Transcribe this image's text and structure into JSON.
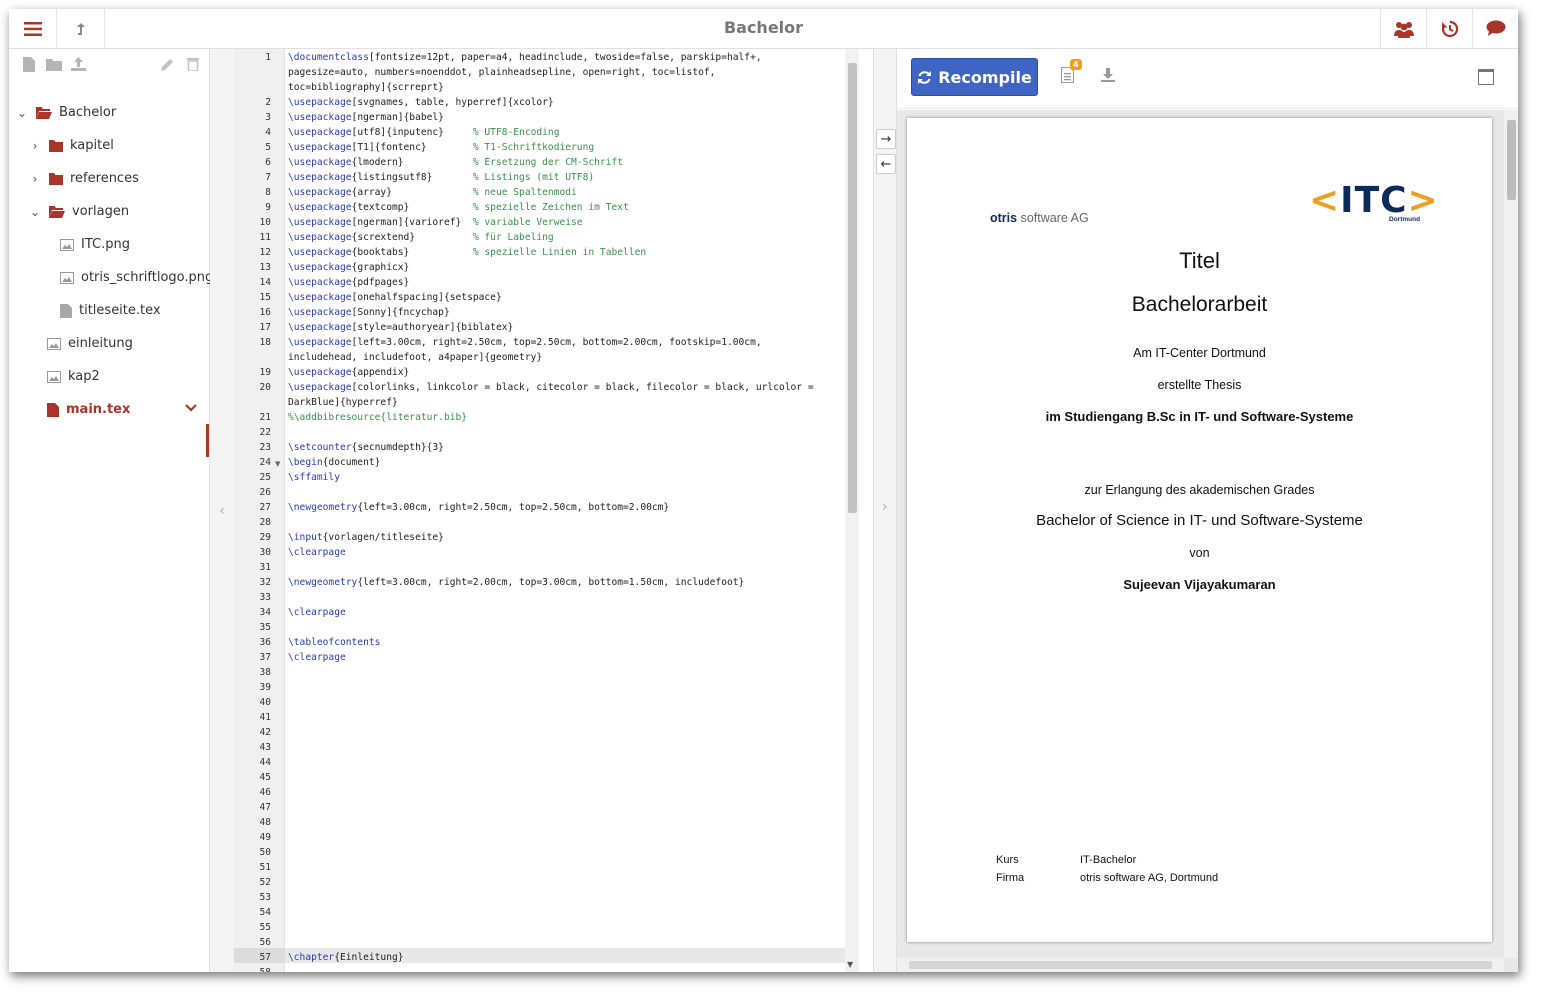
{
  "project_title": "Bachelor",
  "file_tree": {
    "root": "Bachelor",
    "items": [
      {
        "label": "kapitel",
        "type": "folder",
        "expanded": false
      },
      {
        "label": "references",
        "type": "folder",
        "expanded": false
      },
      {
        "label": "vorlagen",
        "type": "folder",
        "expanded": true
      },
      {
        "label": "ITC.png",
        "type": "image"
      },
      {
        "label": "otris_schriftlogo.png",
        "type": "image"
      },
      {
        "label": "titleseite.tex",
        "type": "file"
      },
      {
        "label": "einleitung",
        "type": "image"
      },
      {
        "label": "kap2",
        "type": "image"
      },
      {
        "label": "main.tex",
        "type": "file",
        "selected": true
      }
    ]
  },
  "editor": {
    "line_numbers": [
      "1",
      "",
      "",
      "2",
      "3",
      "4",
      "5",
      "6",
      "7",
      "8",
      "9",
      "10",
      "11",
      "12",
      "13",
      "14",
      "15",
      "16",
      "17",
      "18",
      "",
      "19",
      "20",
      "",
      "21",
      "22",
      "23",
      "24",
      "25",
      "26",
      "27",
      "28",
      "29",
      "30",
      "31",
      "32",
      "33",
      "34",
      "35",
      "36",
      "37",
      "38",
      "39",
      "40",
      "41",
      "42",
      "43",
      "44",
      "45",
      "46",
      "47",
      "48",
      "49",
      "50",
      "51",
      "52",
      "53",
      "54",
      "55",
      "56",
      "57",
      "58"
    ],
    "lines": [
      {
        "k": "\\documentclass",
        "t": "[fontsize=12pt, paper=a4, headinclude, twoside=false, parskip=half+,",
        "c": ""
      },
      {
        "k": "",
        "t": "pagesize=auto, numbers=noenddot, plainheadsepline, open=right, toc=listof,",
        "c": ""
      },
      {
        "k": "",
        "t": "toc=bibliography]{scrreprt}",
        "c": ""
      },
      {
        "k": "\\usepackage",
        "t": "[svgnames, table, hyperref]{xcolor}",
        "c": ""
      },
      {
        "k": "\\usepackage",
        "t": "[ngerman]{babel}",
        "c": ""
      },
      {
        "k": "\\usepackage",
        "t": "[utf8]{inputenc}     ",
        "c": "% UTF8-Encoding"
      },
      {
        "k": "\\usepackage",
        "t": "[T1]{fontenc}        ",
        "c": "% T1-Schriftkodierung"
      },
      {
        "k": "\\usepackage",
        "t": "{lmodern}            ",
        "c": "% Ersetzung der CM-Schrift"
      },
      {
        "k": "\\usepackage",
        "t": "{listingsutf8}       ",
        "c": "% Listings (mit UTF8)"
      },
      {
        "k": "\\usepackage",
        "t": "{array}              ",
        "c": "% neue Spaltenmodi"
      },
      {
        "k": "\\usepackage",
        "t": "{textcomp}           ",
        "c": "% spezielle Zeichen im Text"
      },
      {
        "k": "\\usepackage",
        "t": "[ngerman]{varioref}  ",
        "c": "% variable Verweise"
      },
      {
        "k": "\\usepackage",
        "t": "{scrextend}          ",
        "c": "% für Labeling"
      },
      {
        "k": "\\usepackage",
        "t": "{booktabs}           ",
        "c": "% spezielle Linien in Tabellen"
      },
      {
        "k": "\\usepackage",
        "t": "{graphicx}",
        "c": ""
      },
      {
        "k": "\\usepackage",
        "t": "{pdfpages}",
        "c": ""
      },
      {
        "k": "\\usepackage",
        "t": "[onehalfspacing]{setspace}",
        "c": ""
      },
      {
        "k": "\\usepackage",
        "t": "[Sonny]{fncychap}",
        "c": ""
      },
      {
        "k": "\\usepackage",
        "t": "[style=authoryear]{biblatex}",
        "c": ""
      },
      {
        "k": "\\usepackage",
        "t": "[left=3.00cm, right=2.50cm, top=2.50cm, bottom=2.00cm, footskip=1.00cm,",
        "c": ""
      },
      {
        "k": "",
        "t": "includehead, includefoot, a4paper]{geometry}",
        "c": ""
      },
      {
        "k": "\\usepackage",
        "t": "{appendix}",
        "c": ""
      },
      {
        "k": "\\usepackage",
        "t": "[colorlinks, linkcolor = black, citecolor = black, filecolor = black, urlcolor =",
        "c": ""
      },
      {
        "k": "",
        "t": "DarkBlue]{hyperref}",
        "c": ""
      },
      {
        "k": "",
        "t": "",
        "c": "%\\addbibresource{literatur.bib}"
      },
      {
        "k": "",
        "t": "",
        "c": ""
      },
      {
        "k": "\\setcounter",
        "t": "{secnumdepth}{3}",
        "c": ""
      },
      {
        "k": "\\begin",
        "t": "{document}",
        "c": ""
      },
      {
        "k": "\\sffamily",
        "t": "",
        "c": ""
      },
      {
        "k": "",
        "t": "",
        "c": ""
      },
      {
        "k": "\\newgeometry",
        "t": "{left=3.00cm, right=2.50cm, top=2.50cm, bottom=2.00cm}",
        "c": ""
      },
      {
        "k": "",
        "t": "",
        "c": ""
      },
      {
        "k": "\\input",
        "t": "{vorlagen/titleseite}",
        "c": ""
      },
      {
        "k": "\\clearpage",
        "t": "",
        "c": ""
      },
      {
        "k": "",
        "t": "",
        "c": ""
      },
      {
        "k": "\\newgeometry",
        "t": "{left=3.00cm, right=2.00cm, top=3.00cm, bottom=1.50cm, includefoot}",
        "c": ""
      },
      {
        "k": "",
        "t": "",
        "c": ""
      },
      {
        "k": "\\clearpage",
        "t": "",
        "c": ""
      },
      {
        "k": "",
        "t": "",
        "c": ""
      },
      {
        "k": "\\tableofcontents",
        "t": "",
        "c": ""
      },
      {
        "k": "\\clearpage",
        "t": "",
        "c": ""
      },
      {
        "k": "",
        "t": "",
        "c": ""
      },
      {
        "k": "",
        "t": "",
        "c": ""
      },
      {
        "k": "",
        "t": "",
        "c": ""
      },
      {
        "k": "",
        "t": "",
        "c": ""
      },
      {
        "k": "",
        "t": "",
        "c": ""
      },
      {
        "k": "",
        "t": "",
        "c": ""
      },
      {
        "k": "",
        "t": "",
        "c": ""
      },
      {
        "k": "",
        "t": "",
        "c": ""
      },
      {
        "k": "",
        "t": "",
        "c": ""
      },
      {
        "k": "",
        "t": "",
        "c": ""
      },
      {
        "k": "",
        "t": "",
        "c": ""
      },
      {
        "k": "",
        "t": "",
        "c": ""
      },
      {
        "k": "",
        "t": "",
        "c": ""
      },
      {
        "k": "",
        "t": "",
        "c": ""
      },
      {
        "k": "",
        "t": "",
        "c": ""
      },
      {
        "k": "",
        "t": "",
        "c": ""
      },
      {
        "k": "",
        "t": "",
        "c": ""
      },
      {
        "k": "",
        "t": "",
        "c": ""
      },
      {
        "k": "",
        "t": "",
        "c": ""
      },
      {
        "k": "\\chapter",
        "t": "{Einleitung}",
        "c": ""
      }
    ]
  },
  "pdf": {
    "recompile_label": "Recompile",
    "log_badge": "4",
    "page": {
      "otris_logo_bold": "otris",
      "otris_logo_rest": "software AG",
      "itc_logo": "<ITC>",
      "itc_logo_sub": "Dortmund",
      "title": "Titel",
      "subtitle": "Bachelorarbeit",
      "line1": "Am IT-Center Dortmund",
      "line2": "erstellte Thesis",
      "line3": "im Studiengang B.Sc in IT- und Software-Systeme",
      "line4": "zur Erlangung des akademischen Grades",
      "line5": "Bachelor of Science in IT- und Software-Systeme",
      "line6": "von",
      "author": "Sujeevan Vijayakumaran",
      "kurs_label": "Kurs",
      "kurs_value": "IT-Bachelor",
      "firma_label": "Firma",
      "firma_value": "otris software AG, Dortmund"
    }
  },
  "colors": {
    "accent_red": "#a93529",
    "recompile_blue": "#3e64c4",
    "keyword_blue": "#2a3ab0",
    "comment_green": "#3c8e4e",
    "badge_orange": "#f0a020",
    "itc_orange": "#f0a020",
    "itc_navy": "#0e2a5a"
  }
}
